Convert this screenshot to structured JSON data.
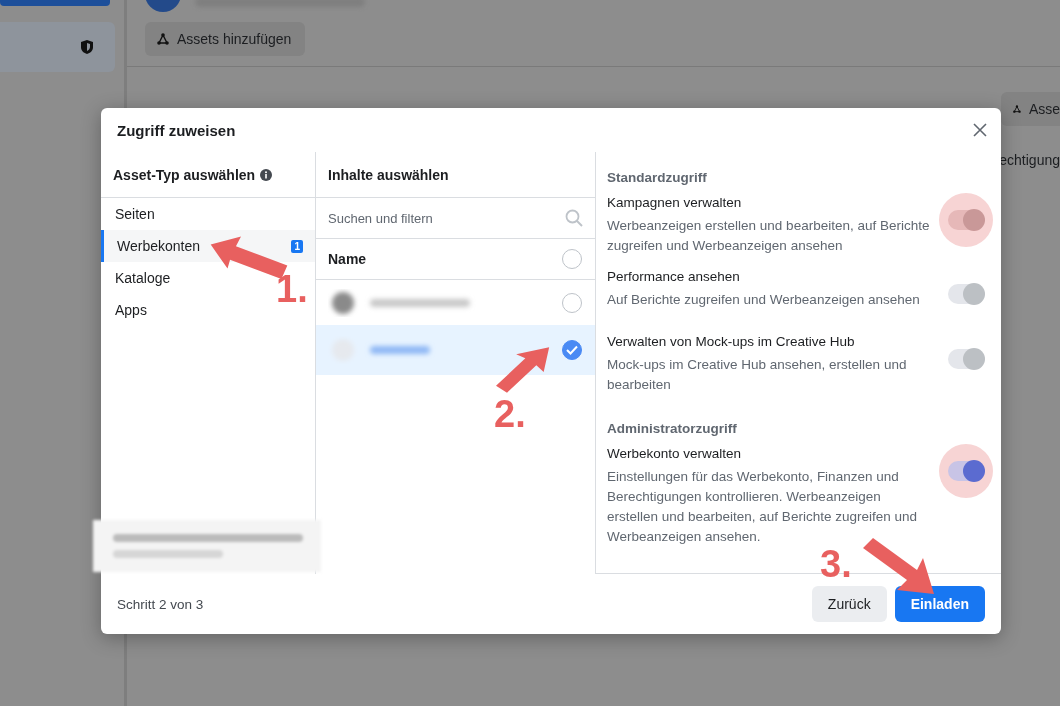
{
  "background": {
    "add_assets_button": "Assets hinzufügen",
    "right_button": "Asse",
    "column_text": "echtigung"
  },
  "dialog": {
    "title": "Zugriff zuweisen",
    "asset_types": {
      "heading": "Asset-Typ auswählen",
      "items": [
        {
          "label": "Seiten",
          "selected": false
        },
        {
          "label": "Werbekonten",
          "selected": true,
          "badge": "1"
        },
        {
          "label": "Kataloge",
          "selected": false
        },
        {
          "label": "Apps",
          "selected": false
        }
      ]
    },
    "content": {
      "heading": "Inhalte auswählen",
      "search": {
        "placeholder": "Suchen und filtern"
      },
      "column": "Name",
      "select_all_checked": false,
      "rows": [
        {
          "selected": false
        },
        {
          "selected": true
        }
      ]
    },
    "permissions": {
      "sections": [
        {
          "heading": "Standardzugriff",
          "items": [
            {
              "title": "Kampagnen verwalten",
              "description": "Werbeanzeigen erstellen und bearbeiten, auf Berichte zugreifen und Werbeanzeigen ansehen",
              "on": true,
              "disabled": true,
              "highlighted": true
            },
            {
              "title": "Performance ansehen",
              "description": "Auf Berichte zugreifen und Werbeanzeigen ansehen",
              "on": true,
              "disabled": true
            },
            {
              "title": "Verwalten von Mock-ups im Creative Hub",
              "description": "Mock-ups im Creative Hub ansehen, erstellen und bearbeiten",
              "on": true,
              "disabled": true
            }
          ]
        },
        {
          "heading": "Administratorzugriff",
          "items": [
            {
              "title": "Werbekonto verwalten",
              "description": "Einstellungen für das Werbekonto, Finanzen und Berechtigungen kontrollieren. Werbeanzeigen erstellen und bearbeiten, auf Berichte zugreifen und Werbeanzeigen ansehen.",
              "on": true,
              "disabled": false,
              "highlighted": true
            }
          ]
        }
      ]
    },
    "footer": {
      "step": "Schritt 2 von 3",
      "buttons": [
        {
          "label": "Zurück",
          "kind": "secondary"
        },
        {
          "label": "Einladen",
          "kind": "primary"
        }
      ]
    }
  },
  "annotations": [
    {
      "label": "1."
    },
    {
      "label": "2."
    },
    {
      "label": "3."
    }
  ]
}
